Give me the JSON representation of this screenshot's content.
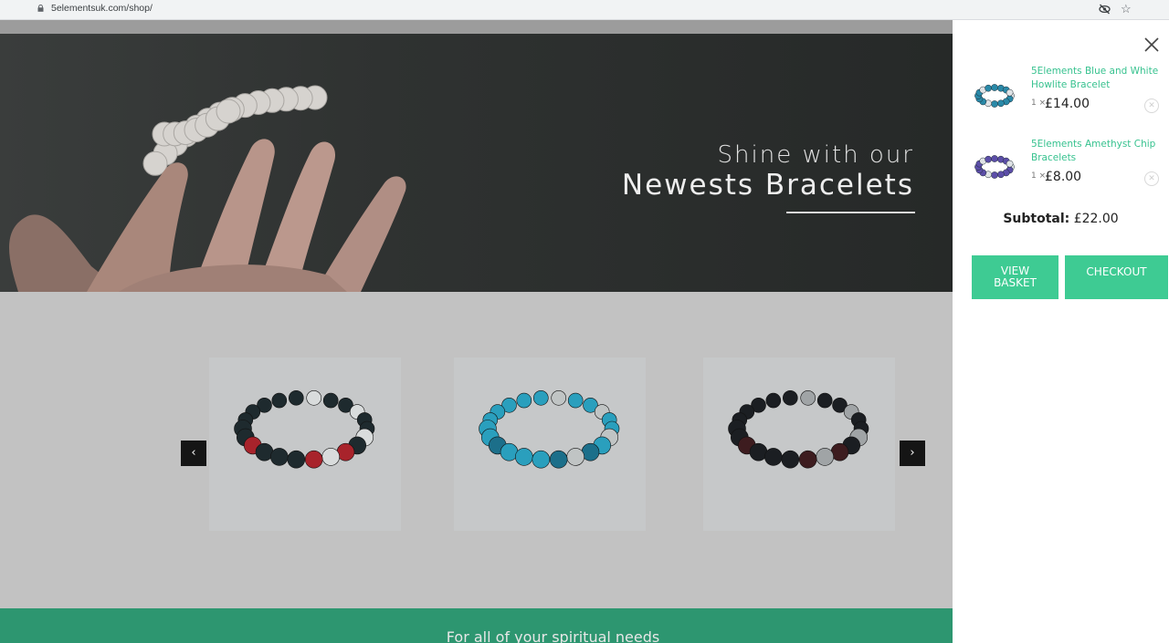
{
  "browser": {
    "url": "5elementsuk.com/shop/",
    "icons": [
      "lock-icon",
      "eye-off-icon",
      "star-icon"
    ]
  },
  "hero": {
    "line1": "Shine with our",
    "line2": "Newests Bracelets"
  },
  "carousel": {
    "prev_label": "‹",
    "next_label": "›",
    "products": [
      {
        "bead_colors": [
          "#1e2a2e",
          "#a8232b",
          "#d9dcdc"
        ]
      },
      {
        "bead_colors": [
          "#2a9fbd",
          "#1c6f8a",
          "#c0c4c4"
        ]
      },
      {
        "bead_colors": [
          "#1b1e22",
          "#3d1c1f",
          "#a0a4a6"
        ]
      }
    ]
  },
  "footer": {
    "tagline": "For all of your spiritual needs"
  },
  "cart": {
    "close_label": "✕",
    "items": [
      {
        "name": "5Elements Blue and White Howlite Bracelet",
        "qty": "1 ×",
        "price": "£14.00",
        "remove_label": "✕",
        "thumb_color": "#2a89a8"
      },
      {
        "name": "5Elements Amethyst Chip Bracelets",
        "qty": "1 ×",
        "price": "£8.00",
        "remove_label": "✕",
        "thumb_color": "#5c4ea8"
      }
    ],
    "subtotal_label": "Subtotal:",
    "subtotal_value": "£22.00",
    "view_basket_label": "View Basket",
    "checkout_label": "Checkout"
  },
  "colors": {
    "accent": "#3ecb93",
    "link": "#37c28f",
    "footer_band": "#2d9670"
  }
}
